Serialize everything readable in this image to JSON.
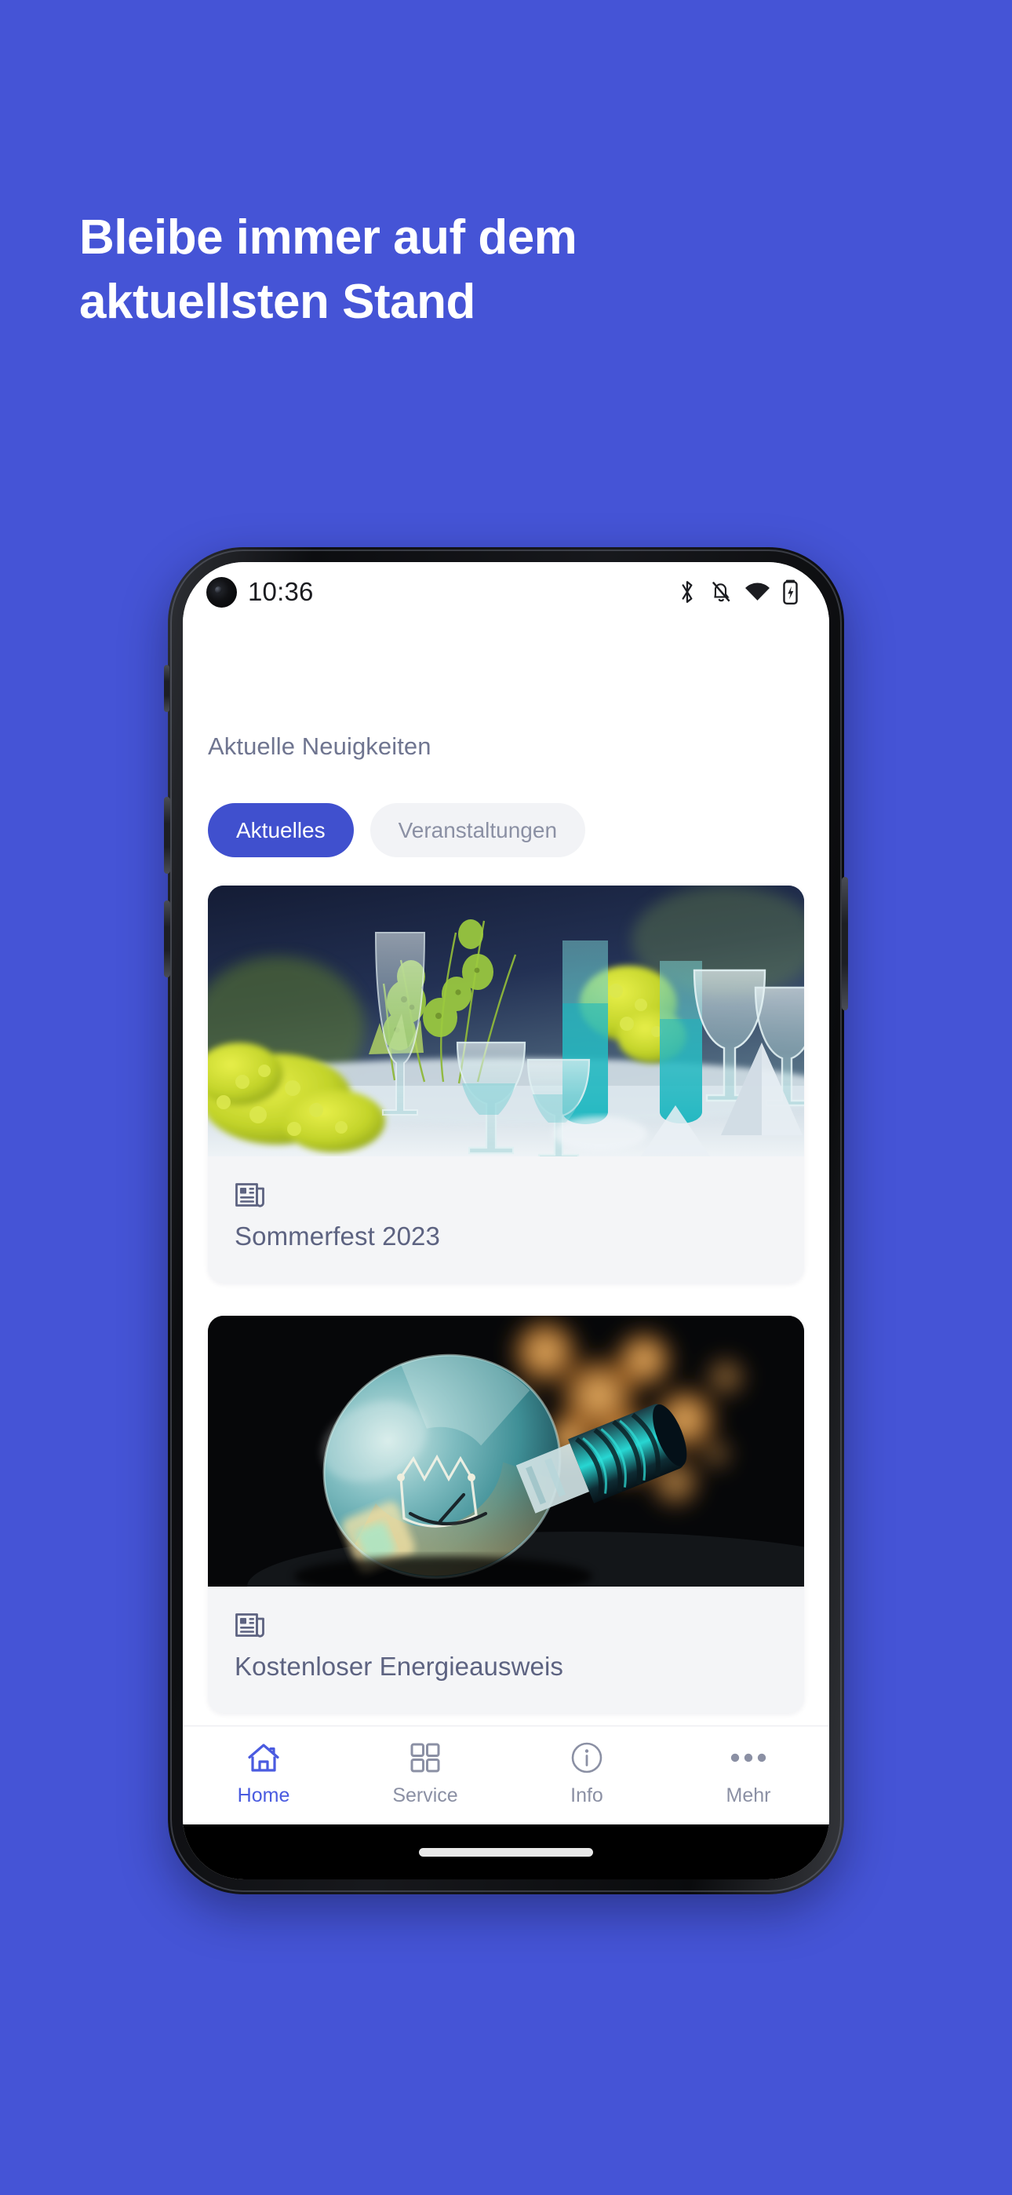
{
  "promo": {
    "background_color": "#4554d6",
    "headline_line1": "Bleibe immer auf dem",
    "headline_line2": "aktuellsten Stand"
  },
  "status_bar": {
    "time": "10:36",
    "icons": [
      {
        "name": "bluetooth-icon"
      },
      {
        "name": "notifications-muted-icon"
      },
      {
        "name": "wifi-icon"
      },
      {
        "name": "battery-charging-icon"
      }
    ]
  },
  "main": {
    "section_title": "Aktuelle Neuigkeiten",
    "filter_chips": [
      {
        "label": "Aktuelles",
        "active": true,
        "color": "#4050ce"
      },
      {
        "label": "Veranstaltungen",
        "active": false,
        "color": "#f2f3f6"
      }
    ],
    "cards": [
      {
        "icon": "newspaper-icon",
        "title": "Sommerfest 2023",
        "image_alt": "festive-table-setting-with-glasses-and-flowers"
      },
      {
        "icon": "newspaper-icon",
        "title": "Kostenloser Energieausweis",
        "image_alt": "vintage-light-bulb-with-bokeh-lights"
      }
    ]
  },
  "bottom_nav": {
    "active_color": "#4a5be0",
    "inactive_color": "#8b90a4",
    "items": [
      {
        "label": "Home",
        "icon": "home-icon",
        "active": true
      },
      {
        "label": "Service",
        "icon": "grid-icon",
        "active": false
      },
      {
        "label": "Info",
        "icon": "info-icon",
        "active": false
      },
      {
        "label": "Mehr",
        "icon": "more-dots-icon",
        "active": false
      }
    ]
  }
}
